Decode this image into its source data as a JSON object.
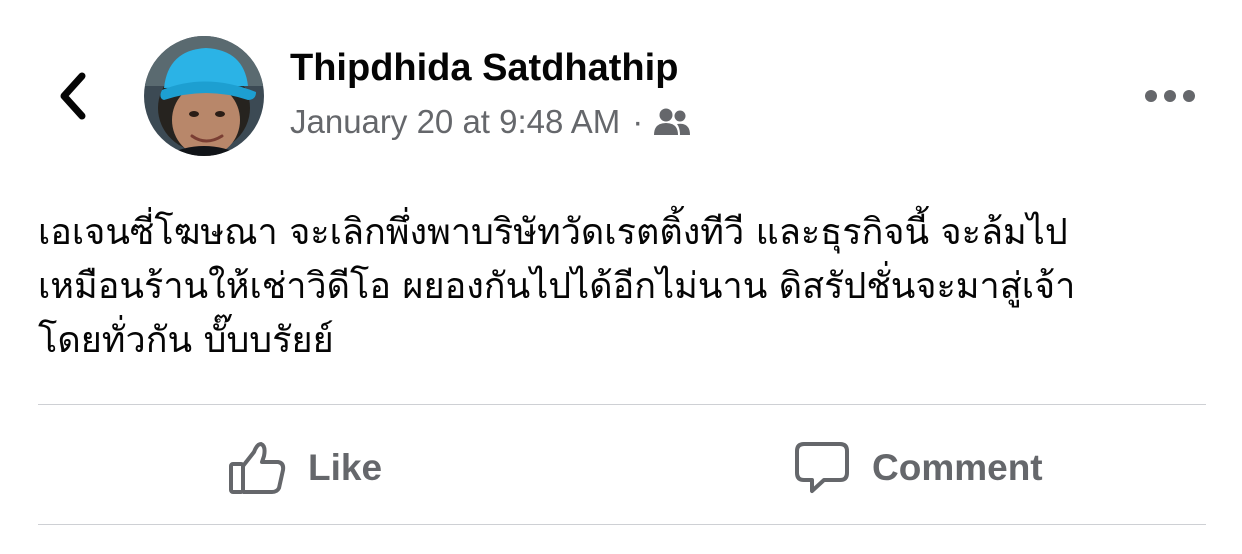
{
  "post": {
    "author": "Thipdhida Satdhathip",
    "timestamp": "January 20 at 9:48 AM",
    "separator": "·",
    "text_lines": [
      "เอเจนซี่โฆษณา จะเลิกพึ่งพาบริษัทวัดเรตติ้งทีวี และธุรกิจนี้ จะล้มไป",
      "เหมือนร้านให้เช่าวิดีโอ ผยองกันไปได้อีกไม่นาน ดิสรัปชั่นจะมาสู่เจ้า",
      "โดยทั่วกัน บั๊บบรัยย์"
    ]
  },
  "icons": {
    "back": "chevron-left-icon",
    "audience": "friends-icon",
    "more": "more-horizontal-icon",
    "like": "thumbs-up-icon",
    "comment": "comment-bubble-icon"
  },
  "actions": {
    "like_label": "Like",
    "comment_label": "Comment"
  },
  "colors": {
    "text_primary": "#050505",
    "text_secondary": "#65676b",
    "divider": "#ced0d4",
    "avatar_cap": "#2bb3e6"
  }
}
